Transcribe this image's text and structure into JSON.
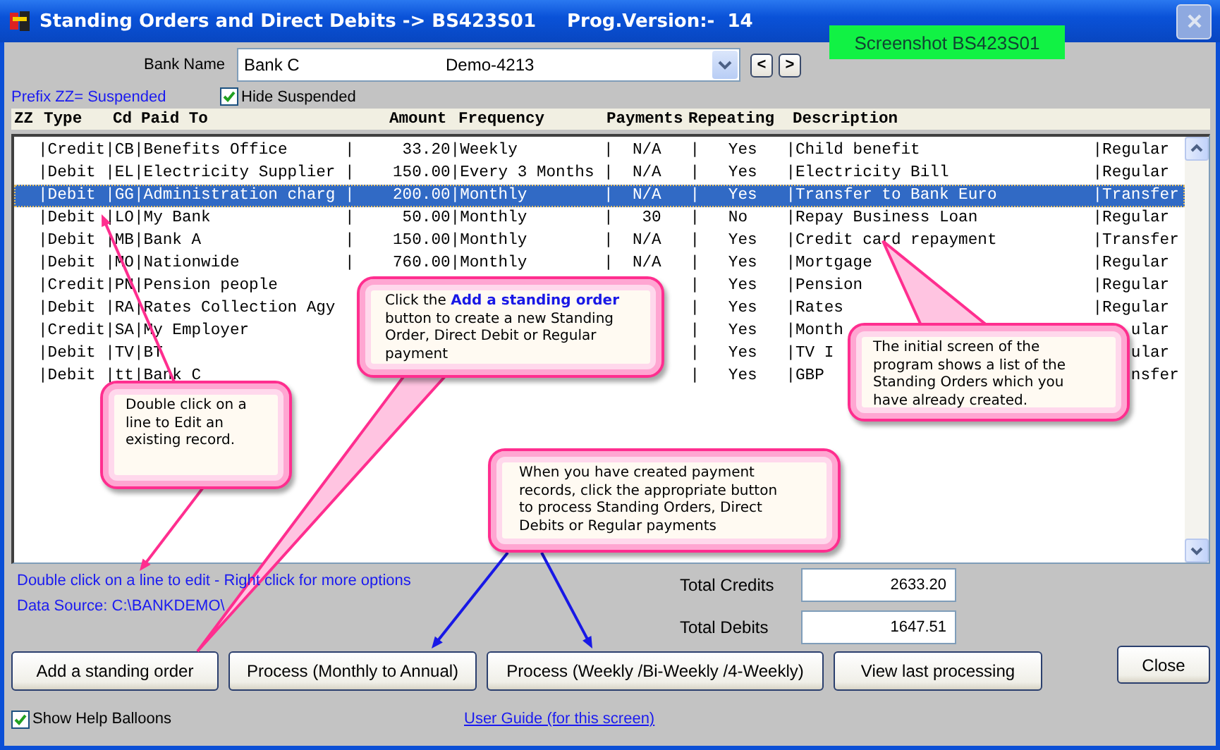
{
  "window": {
    "title": "Standing Orders and Direct Debits -> BS423S01",
    "version": "Prog.Version:-  14"
  },
  "badge": "Screenshot BS423S01",
  "bank": {
    "label": "Bank Name",
    "value": "Bank C",
    "account": "Demo-4213"
  },
  "nav_buttons": [
    "<",
    ">"
  ],
  "prefix_note": "Prefix ZZ= Suspended",
  "hide_suspended": {
    "label": "Hide Suspended",
    "checked": true
  },
  "columns": [
    "ZZ",
    "Type",
    "Cd",
    "Paid To",
    "Amount",
    "Frequency",
    "Payments",
    "Repeating",
    "Description"
  ],
  "rows": [
    {
      "selected": false,
      "type": "|Credit",
      "cd": "|CB",
      "paid_to": "|Benefits Office",
      "amount": "|     33.20",
      "frequency": "|Weekly",
      "payments": "|  N/A",
      "repeating": "|   Yes",
      "description": "|Child benefit",
      "category": "|Regular"
    },
    {
      "selected": false,
      "type": "|Debit",
      "cd": "|EL",
      "paid_to": "|Electricity Supplier",
      "amount": "|    150.00",
      "frequency": "|Every 3 Months",
      "payments": "|  N/A",
      "repeating": "|   Yes",
      "description": "|Electricity Bill",
      "category": "|Regular"
    },
    {
      "selected": true,
      "type": "|Debit",
      "cd": "|GG",
      "paid_to": "|Administration charg",
      "amount": "|    200.00",
      "frequency": "|Monthly",
      "payments": "|  N/A",
      "repeating": "|   Yes",
      "description": "|Transfer to Bank Euro",
      "category": "|Transfer"
    },
    {
      "selected": false,
      "type": "|Debit",
      "cd": "|LO",
      "paid_to": "|My Bank",
      "amount": "|     50.00",
      "frequency": "|Monthly",
      "payments": "|   30",
      "repeating": "|   No",
      "description": "|Repay Business Loan",
      "category": "|Regular"
    },
    {
      "selected": false,
      "type": "|Debit",
      "cd": "|MB",
      "paid_to": "|Bank A",
      "amount": "|    150.00",
      "frequency": "|Monthly",
      "payments": "|  N/A",
      "repeating": "|   Yes",
      "description": "|Credit card repayment",
      "category": "|Transfer"
    },
    {
      "selected": false,
      "type": "|Debit",
      "cd": "|MO",
      "paid_to": "|Nationwide",
      "amount": "|    760.00",
      "frequency": "|Monthly",
      "payments": "|  N/A",
      "repeating": "|   Yes",
      "description": "|Mortgage",
      "category": "|Regular"
    },
    {
      "selected": false,
      "type": "|Credit",
      "cd": "|PN",
      "paid_to": "|Pension people",
      "repeating": "|   Yes",
      "description": "|Pension",
      "category": "|Regular"
    },
    {
      "selected": false,
      "type": "|Debit",
      "cd": "|RA",
      "paid_to": "|Rates Collection Agy",
      "repeating": "|   Yes",
      "description": "|Rates",
      "category": "|Regular"
    },
    {
      "selected": false,
      "type": "|Credit",
      "cd": "|SA",
      "paid_to": "|My Employer",
      "repeating": "|   Yes",
      "description": "|Month",
      "category": "    ular"
    },
    {
      "selected": false,
      "type": "|Debit",
      "cd": "|TV",
      "paid_to": "|BT",
      "repeating": "|   Yes",
      "description": "|TV I",
      "category": "    ular"
    },
    {
      "selected": false,
      "type": "|Debit",
      "cd": "|tt",
      "paid_to": "|Bank C",
      "repeating": "|   Yes",
      "description": "|GBP",
      "category": "    nsfer"
    }
  ],
  "callouts": [
    {
      "text": "Click the **Add a standing order** button to create a new Standing Order, Direct Debit or Regular payment"
    },
    {
      "text": "The initial screen of the program shows a list of the Standing Orders which you have already created."
    },
    {
      "text": "Double click on a line to Edit an existing record."
    },
    {
      "text": "When you have created payment records, click the appropriate button to process Standing Orders, Direct Debits or Regular payments"
    }
  ],
  "hint": "Double click on a line to edit - Right click for more options",
  "data_source": "Data Source: C:\\BANKDEMO\\",
  "totals": [
    {
      "label": "Total Credits",
      "value": "2633.20"
    },
    {
      "label": "Total Debits",
      "value": "1647.51"
    }
  ],
  "buttons": [
    "Add a standing order",
    "Process (Monthly to Annual)",
    "Process (Weekly /Bi-Weekly /4-Weekly)",
    "View last processing"
  ],
  "close_button": "Close",
  "show_help": {
    "label": "Show Help Balloons",
    "checked": true
  },
  "user_guide": "User Guide (for this screen)"
}
